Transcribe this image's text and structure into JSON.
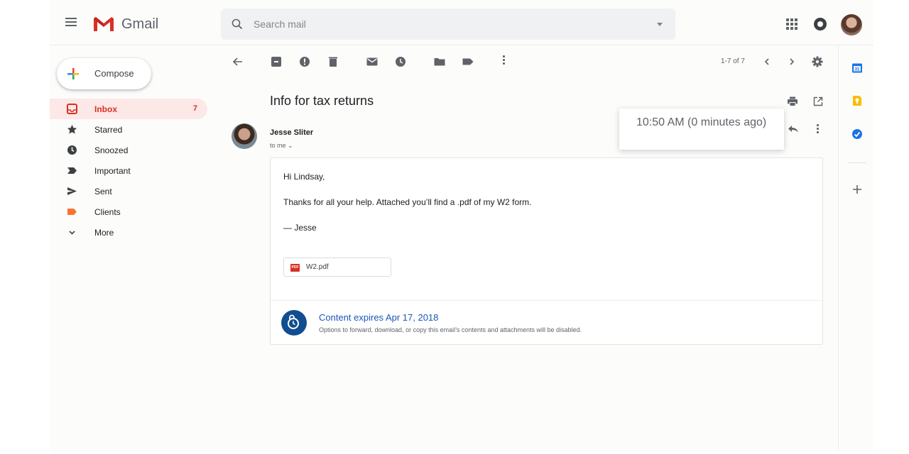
{
  "header": {
    "app_name": "Gmail",
    "search_placeholder": "Search mail"
  },
  "sidebar": {
    "compose_label": "Compose",
    "items": [
      {
        "label": "Inbox",
        "count": "7",
        "icon": "inbox-icon",
        "active": true
      },
      {
        "label": "Starred",
        "count": "",
        "icon": "star-icon"
      },
      {
        "label": "Snoozed",
        "count": "",
        "icon": "clock-icon"
      },
      {
        "label": "Important",
        "count": "",
        "icon": "important-icon"
      },
      {
        "label": "Sent",
        "count": "",
        "icon": "send-icon"
      },
      {
        "label": "Clients",
        "count": "",
        "icon": "label-icon"
      },
      {
        "label": "More",
        "count": "",
        "icon": "chevron-down-icon"
      }
    ]
  },
  "toolbar": {
    "pager": "1-7 of 7"
  },
  "message": {
    "subject": "Info for tax returns",
    "sender": "Jesse Sliter",
    "to": "to me ⌄",
    "timestamp_tooltip": "10:50 AM (0 minutes ago)",
    "body": {
      "greeting": "Hi Lindsay,",
      "text": "Thanks for all your help. Attached you’ll find a .pdf of my W2 form.",
      "signoff": "— Jesse"
    },
    "attachment": {
      "badge": "PDF",
      "filename": "W2.pdf"
    },
    "confidential": {
      "title": "Content expires Apr 17, 2018",
      "description": "Options to forward, download, or copy this email’s contents and attachments will be disabled."
    }
  },
  "colors": {
    "gmail_red": "#d93025",
    "accent_blue": "#1a56b8",
    "confidential_blue": "#114e90",
    "active_bg": "#fce8e6"
  }
}
